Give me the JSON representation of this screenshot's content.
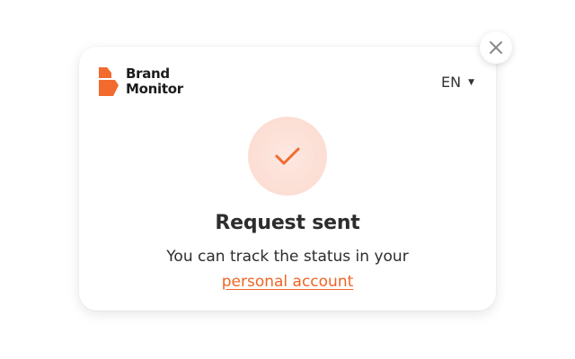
{
  "brand": {
    "line1": "Brand",
    "line2": "Monitor",
    "accent_color": "#F26A2E"
  },
  "language": {
    "current": "EN"
  },
  "close": {
    "icon": "close-icon"
  },
  "status": {
    "icon": "checkmark-icon",
    "title": "Request sent",
    "message": "You can track the status in your",
    "link_text": "personal account"
  }
}
